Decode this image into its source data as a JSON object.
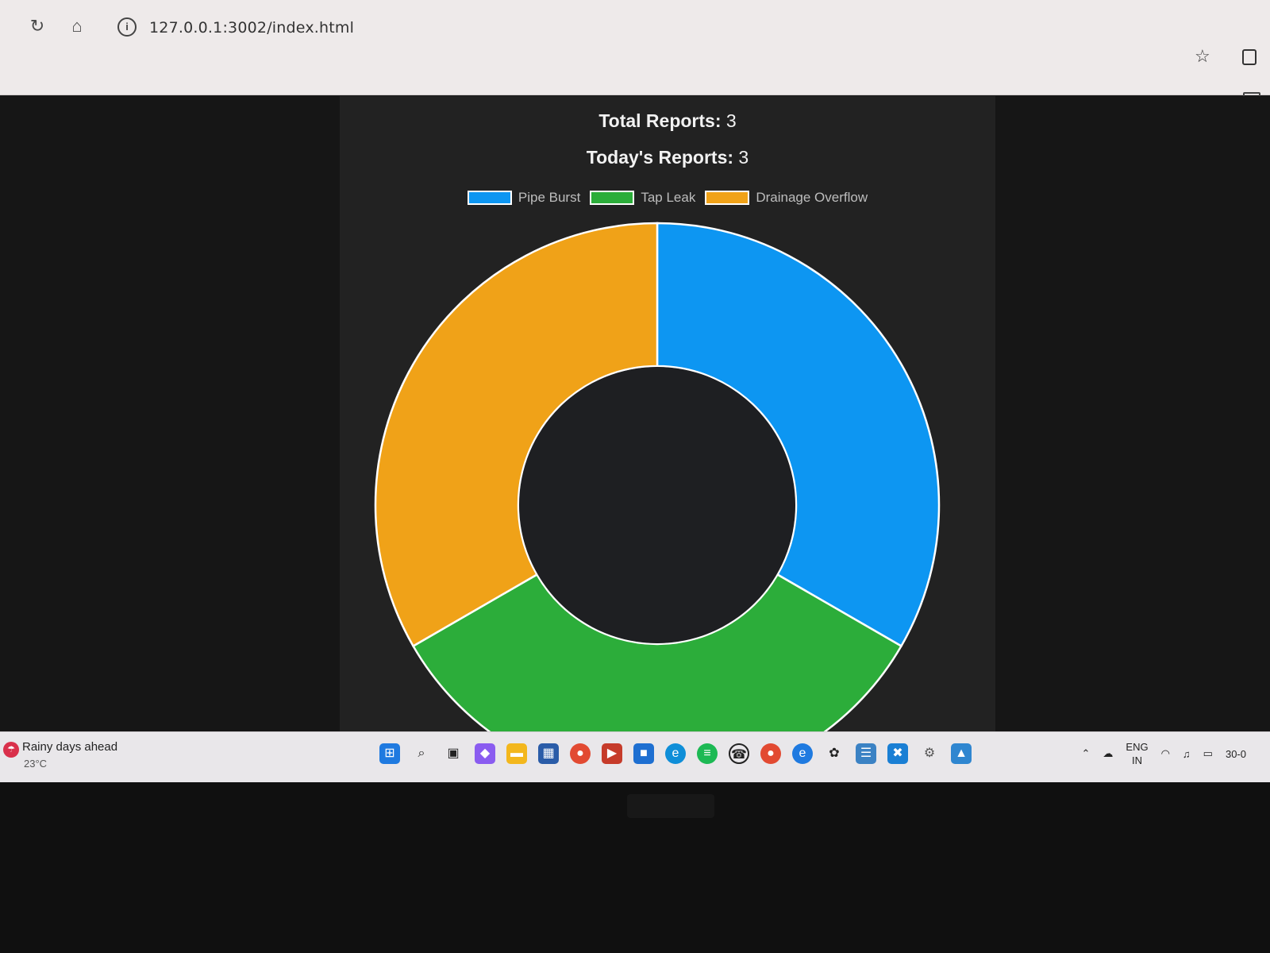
{
  "browser": {
    "url": "127.0.0.1:3002/index.html"
  },
  "stats": {
    "total_label": "Total Reports:",
    "total_value": "3",
    "today_label": "Today's Reports:",
    "today_value": "3"
  },
  "chart_data": {
    "type": "pie",
    "donut": true,
    "categories": [
      "Pipe Burst",
      "Tap Leak",
      "Drainage Overflow"
    ],
    "values": [
      1,
      1,
      1
    ],
    "colors": [
      "#0d96f2",
      "#2cad3a",
      "#f0a218"
    ],
    "legend": "top",
    "title": ""
  },
  "taskbar": {
    "weather_title": "Rainy days ahead",
    "weather_temp": "23°C",
    "lang_top": "ENG",
    "lang_bottom": "IN",
    "date": "30-0"
  }
}
